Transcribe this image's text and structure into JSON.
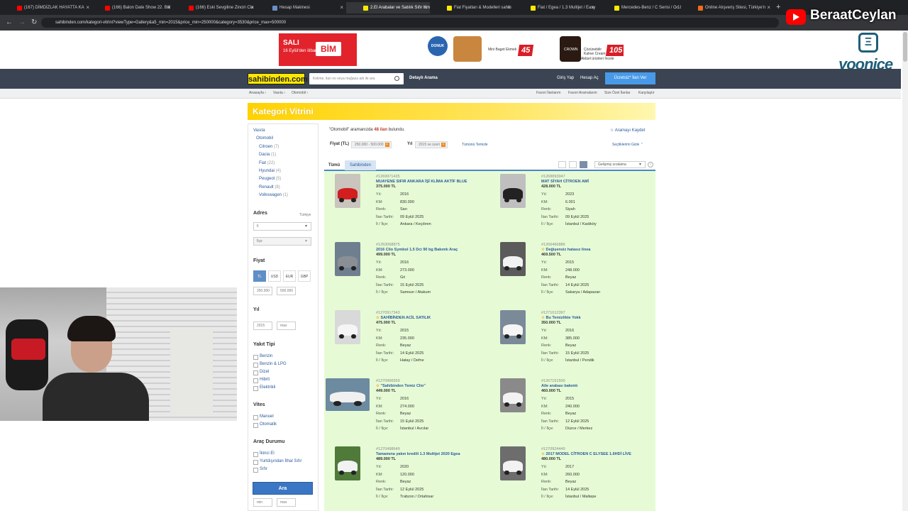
{
  "browser": {
    "tabs": [
      {
        "title": "(167) DİMDİZLAK HAYATTA KA",
        "color": "#ff0000",
        "left": 0
      },
      {
        "title": "(166) Balon Date Show 22. Böl",
        "color": "#ff0000",
        "left": 0
      },
      {
        "title": "(166) Eski Sevgiline Zinciri Cla",
        "color": "#ff0000",
        "left": 0
      },
      {
        "title": "Hesap Makinesi",
        "color": "#6a8ec8",
        "left": 0
      },
      {
        "title": "2.El Arabalar ve Satılık Sıfır Km",
        "color": "#ffe800",
        "left": 0
      },
      {
        "title": "Fiat Fiyatları & Modelleri sahib",
        "color": "#ffe800",
        "left": 0
      },
      {
        "title": "Fiat / Egea / 1.3 Multijet / Easy",
        "color": "#ffe800",
        "left": 0
      },
      {
        "title": "Mercedes-Benz / C Serisi / C 18",
        "color": "#ffe800",
        "left": 0
      },
      {
        "title": "Online Alışveriş Sitesi, Türkiye'n",
        "color": "#f26a1b",
        "left": 0
      }
    ],
    "url": "sahibinden.com/kategori-vitrini?viewType=Gallery&a5_min=2015&price_min=250000&category=3530&price_max=500000"
  },
  "overlay": {
    "channel_name": "BeraatCeylan",
    "brand_text": "yoonice"
  },
  "ad": {
    "sali": "SALI",
    "date": "16 Eylül'den itibaren",
    "bim": "BİM",
    "donuk": "DONUK ÜRÜN",
    "p1_text": "Mini Baget Ekmek",
    "p1_price": "45",
    "p2_brand": "CROWN",
    "p2_text": "Çözünebilir Kahve Cream",
    "p2_price": "105",
    "link": "Aktüel ürünleri İncele"
  },
  "header": {
    "logo": "sahibinden.com",
    "search_placeholder": "Kelime, ilan no veya mağaza adı ile ara",
    "detailed_search": "Detaylı Arama",
    "login": "Giriş Yap",
    "register": "Hesap Aç",
    "post_ad": "Ücretsiz* İlan Ver"
  },
  "breadcrumb": {
    "items": [
      "Anasayfa ›",
      "Vasıta ›",
      "Otomobil ›"
    ],
    "right": [
      "Favori İlanlarım",
      "Favori Aramalarım",
      "Size Özel İlanlar",
      "Karşılaştır"
    ]
  },
  "page": {
    "title": "Kategori Vitrini"
  },
  "sidebar": {
    "categories": [
      {
        "label": "Vasıta",
        "count": ""
      },
      {
        "label": "Otomobil",
        "count": ""
      },
      {
        "label": "Citroen",
        "count": "(7)"
      },
      {
        "label": "Dacia",
        "count": "(1)"
      },
      {
        "label": "Fiat",
        "count": "(22)"
      },
      {
        "label": "Hyundai",
        "count": "(4)"
      },
      {
        "label": "Peugeot",
        "count": "(5)"
      },
      {
        "label": "Renault",
        "count": "(8)"
      },
      {
        "label": "Volkswagen",
        "count": "(1)"
      }
    ],
    "address_title": "Adres",
    "address_country": "Türkiye",
    "il_placeholder": "İl",
    "ilce_placeholder": "İlçe",
    "price_title": "Fiyat",
    "currencies": [
      "TL",
      "USD",
      "EUR",
      "GBP"
    ],
    "price_min": "250.000",
    "price_max": "500.000",
    "year_title": "Yıl",
    "year_min": "2015",
    "year_max": "max",
    "fuel_title": "Yakıt Tipi",
    "fuel_options": [
      "Benzin",
      "Benzin & LPG",
      "Dizel",
      "Hibrit",
      "Elektrikli"
    ],
    "gear_title": "Vites",
    "gear_options": [
      "Manuel",
      "Otomatik"
    ],
    "condition_title": "Araç Durumu",
    "condition_options": [
      "İkinci El",
      "Yurtdışından İthal Sıfır",
      "Sıfır"
    ],
    "search_button": "Ara",
    "bottom_min": "min",
    "bottom_max": "max"
  },
  "results": {
    "query": "\"Otomobil\"",
    "summary_mid": " aramanızda ",
    "count": "48 ilan",
    "summary_end": " bulundu.",
    "save_search": "☆ Aramayı Kaydet",
    "price_label": "Fiyat (TL)",
    "price_chip": "250.000 - 500.000",
    "year_label": "Yıl",
    "year_chip": "2015 ve üzeri",
    "clear_all": "Tümünü Temizle",
    "show_selected": "Seçtiklerimi Gizle ⌃",
    "tab_all": "Tümü",
    "tab_owner": "Sahibinden",
    "sort": "Gelişmiş sıralama"
  },
  "labels": {
    "year": "Yıl:",
    "km": "KM:",
    "color": "Renk:",
    "date": "İlan Tarihi:",
    "location": "İl / İlçe:"
  },
  "listings": [
    {
      "no": "#1269971435",
      "title": "MUAYENE SIFIR ANKARA İŞİ KLİMA AKTİF BLUE",
      "star": false,
      "price": "375.000 TL",
      "year": "2016",
      "km": "830.000",
      "color": "Sarı",
      "date": "09 Eylül 2025",
      "loc": "Ankara / Keçiören",
      "car_color": "#d21e1e",
      "bg": "#c9c4bd",
      "wide": false
    },
    {
      "no": "#1268893947",
      "title": "MAT SİYAH CİTROEN AMİ",
      "star": false,
      "price": "428.000 TL",
      "year": "2023",
      "km": "6.001",
      "color": "Siyah",
      "date": "09 Eylül 2025",
      "loc": "İstanbul / Kadıköy",
      "car_color": "#222222",
      "bg": "#bfbfbf",
      "wide": false
    },
    {
      "no": "#1263068875",
      "title": "2016 Clio Symbol 1.5 Dci 90 bg Bakımlı Araç",
      "star": false,
      "price": "499.000 TL",
      "year": "2016",
      "km": "273.000",
      "color": "Gri",
      "date": "15 Eylül 2025",
      "loc": "Samsun / Atakum",
      "car_color": "#8a8f96",
      "bg": "#6f7f8f",
      "wide": false
    },
    {
      "no": "#1266466886",
      "title": "Değişensiz hatasız linea",
      "star": true,
      "price": "469.500 TL",
      "year": "2015",
      "km": "248.000",
      "color": "Beyaz",
      "date": "14 Eylül 2025",
      "loc": "Sakarya / Adapazarı",
      "car_color": "#f2f2f2",
      "bg": "#5b5b5b",
      "wide": false
    },
    {
      "no": "#1270917343",
      "title": "SAHİBİNDEN ACİL SATILIK",
      "star": true,
      "price": "475.000 TL",
      "year": "2015",
      "km": "235.000",
      "color": "Beyaz",
      "date": "14 Eylül 2025",
      "loc": "Hatay / Defne",
      "car_color": "#f5f5f5",
      "bg": "#d9d9d9",
      "wide": false
    },
    {
      "no": "#1271012397",
      "title": "Bu Temizlikte Yokk",
      "star": true,
      "price": "350.000 TL",
      "year": "2016",
      "km": "385.000",
      "color": "Beyaz",
      "date": "15 Eylül 2025",
      "loc": "İstanbul / Pendik",
      "car_color": "#f5f5f5",
      "bg": "#7a8a99",
      "wide": false
    },
    {
      "no": "#1270966559",
      "title": "\"Sahibinden Temiz Clio\"",
      "star": true,
      "price": "449.000 TL",
      "year": "2016",
      "km": "274.000",
      "color": "Beyaz",
      "date": "15 Eylül 2025",
      "loc": "İstanbul / Avcılar",
      "car_color": "#f0f0f0",
      "bg": "#6c8aa0",
      "wide": true
    },
    {
      "no": "#1267151500",
      "title": "Aile arabası bakımlı",
      "star": false,
      "price": "460.000 TL",
      "year": "2015",
      "km": "240.000",
      "color": "Beyaz",
      "date": "12 Eylül 2025",
      "loc": "Düzce / Merkez",
      "car_color": "#f2f2f2",
      "bg": "#8a8a8a",
      "wide": false
    },
    {
      "no": "#1270498649",
      "title": "Tamamına yakın kredili 1.3 Multijet 2020 Egea",
      "star": false,
      "price": "489.000 TL",
      "year": "2020",
      "km": "120.000",
      "color": "Beyaz",
      "date": "12 Eylül 2025",
      "loc": "Trabzon / Ortahisar",
      "car_color": "#f2f2f2",
      "bg": "#4f7a3a",
      "wide": false
    },
    {
      "no": "#1270924449",
      "title": "2017 MODEL CİTROEN C ELYSEE 1.6HDİ LİVE",
      "star": true,
      "price": "480.000 TL",
      "year": "2017",
      "km": "260.000",
      "color": "Beyaz",
      "date": "14 Eylül 2025",
      "loc": "İstanbul / Maltepe",
      "car_color": "#f2f2f2",
      "bg": "#6d6d6d",
      "wide": false
    }
  ]
}
